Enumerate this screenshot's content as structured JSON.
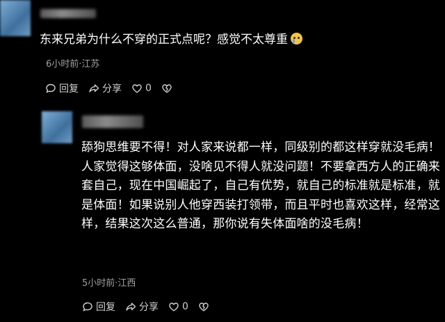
{
  "comment1": {
    "text": "东来兄弟为什么不穿的正式点呢？感觉不太尊重",
    "meta": "6小时前·江苏",
    "actions": {
      "reply": "回复",
      "share": "分享",
      "likes": "0"
    }
  },
  "comment2": {
    "text": "舔狗思维要不得！对人家来说都一样，同级别的都这样穿就没毛病！人家觉得这够体面，没啥见不得人就没问题！不要拿西方人的正确来套自己，现在中国崛起了，自己有优势，就自己的标准就是标准，就是体面！如果说别人他穿西装打领带，而且平时也喜欢这样，经常这样，结果这次这么普通，那你说有失体面啥的没毛病！",
    "meta": "5小时前·江西",
    "actions": {
      "reply": "回复",
      "share": "分享",
      "likes": "0"
    }
  },
  "icons": [
    "reply-icon",
    "share-icon",
    "like-icon",
    "dislike-icon",
    "crying-emoji-icon"
  ]
}
